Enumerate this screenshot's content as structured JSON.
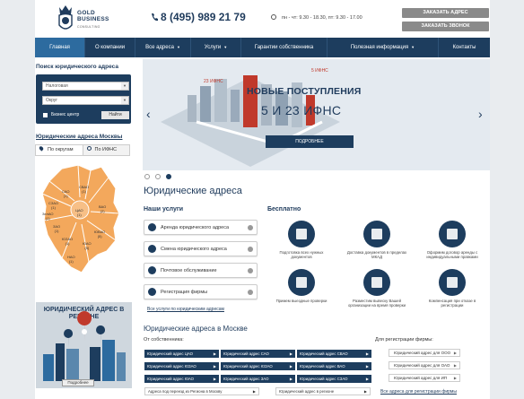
{
  "header": {
    "logo_line1": "GOLD",
    "logo_line2": "BUSINESS",
    "logo_sub": "CONSULTING",
    "phone": "8 (495) 989 21 79",
    "hours": "пн - чт: 9.30 - 18.30, пт: 9.30 - 17.00",
    "btn_order_address": "ЗАКАЗАТЬ АДРЕС",
    "btn_order_call": "ЗАКАЗАТЬ ЗВОНОК"
  },
  "nav": [
    {
      "label": "Главная",
      "active": true
    },
    {
      "label": "О компании"
    },
    {
      "label": "Все адреса",
      "caret": true
    },
    {
      "label": "Услуги",
      "caret": true
    },
    {
      "label": "Гарантии собственника"
    },
    {
      "label": "Полезная информация",
      "caret": true
    },
    {
      "label": "Контакты"
    }
  ],
  "search": {
    "title": "Поиск юридического адреса",
    "select1": "Налоговая",
    "select2": "Округ",
    "checkbox_label": "Бизнес центр",
    "find_btn": "Найти"
  },
  "sidebar": {
    "link": "Юридические адреса Москвы",
    "tab1": "По округам",
    "tab2": "По ИФНС"
  },
  "map_labels": [
    {
      "text": "САО\n(1)"
    },
    {
      "text": "СВАО\n(1)"
    },
    {
      "text": "СЗАО\n(1)"
    },
    {
      "text": "ВАО\n(2)"
    },
    {
      "text": "ЦАО\n(1)"
    },
    {
      "text": "ЗАО\n(1)"
    },
    {
      "text": "ЮВАО\n(5)"
    },
    {
      "text": "ЮАО\n(5)"
    },
    {
      "text": "ЮЗАО\n(1)"
    },
    {
      "text": "ЗелАО\n(1)"
    },
    {
      "text": "НАО\n(1)"
    }
  ],
  "promo": {
    "title": "ЮРИДИЧЕСКИЙ АДРЕС В РЕГИОНЕ",
    "button": "Подробнее"
  },
  "slider": {
    "title": "НОВЫЕ ПОСТУПЛЕНИЯ",
    "subtitle": "5 И 23 ИФНС",
    "button": "ПОДРОБНЕЕ",
    "tag_left": "23 ИФНС",
    "tag_right": "5 ИФНС"
  },
  "main": {
    "title": "Юридические адреса",
    "services_title": "Наши услуги",
    "free_title": "Бесплатно",
    "services": [
      {
        "label": "Аренда юридического адреса"
      },
      {
        "label": "Смена юридического адреса"
      },
      {
        "label": "Почтовое обслуживание"
      },
      {
        "label": "Регистрация фирмы"
      }
    ],
    "all_services": "Все услуги по юридическим адресам",
    "free_items": [
      {
        "text": "Подготовка всех нужных документов"
      },
      {
        "text": "Доставка документов в пределах МКАД"
      },
      {
        "text": "Оформим договор аренды с индивидуальными правками"
      },
      {
        "text": "Примем выездные проверки"
      },
      {
        "text": "Разместим вывеску Вашей организации на время проверки"
      },
      {
        "text": "Компенсация при отказе в регистрации"
      }
    ]
  },
  "moscow": {
    "title": "Юридические адреса в Москве",
    "owner_label": "От собственника:",
    "reg_label": "Для регистрации фирмы:",
    "chips": [
      [
        "Юридический адрес ЦАО",
        "Юридический адрес САО",
        "Юридический адрес СВАО"
      ],
      [
        "Юридический адрес ЮЗАО",
        "Юридический адрес ЮЗАО",
        "Юридический адрес ВАО"
      ],
      [
        "Юридический адрес ЮАО",
        "Юридический адрес ЗАО",
        "Юридический адрес СЗАО"
      ],
      [
        "Адреса под переезд из Региона в Москву",
        "Юридический адрес в регионе"
      ]
    ],
    "reg_chips": [
      "Юридический адрес для ООО",
      "Юридический адрес для ОАО",
      "Юридический адрес для ИП"
    ],
    "all_reg": "Все адреса для регистрации фирмы"
  }
}
